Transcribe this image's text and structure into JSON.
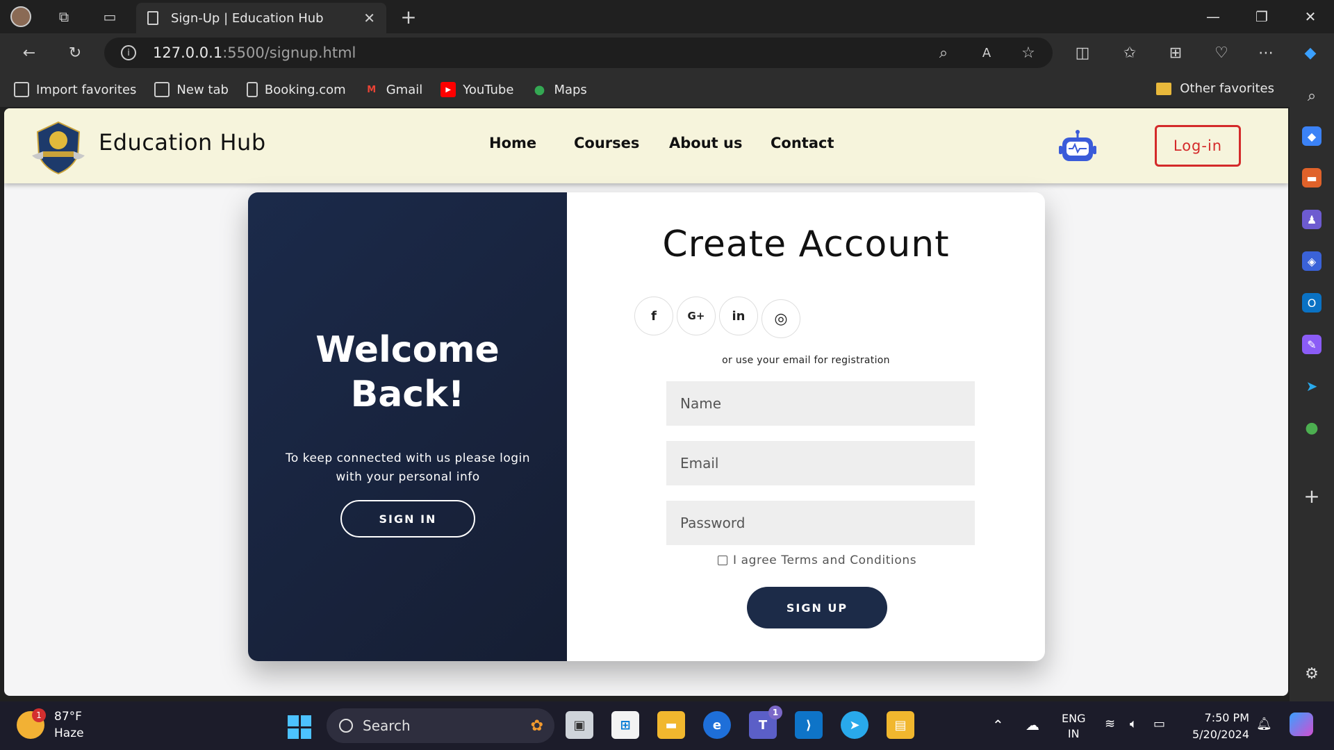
{
  "browser": {
    "tab_title": "Sign-Up | Education Hub",
    "url_host": "127.0.0.1",
    "url_rest": ":5500/signup.html",
    "favorites": [
      {
        "label": "Import favorites",
        "icon": "import-icon"
      },
      {
        "label": "New tab",
        "icon": "new-tab-icon"
      },
      {
        "label": "Booking.com",
        "icon": "page-icon"
      },
      {
        "label": "Gmail",
        "icon": "gmail-icon"
      },
      {
        "label": "YouTube",
        "icon": "youtube-icon"
      },
      {
        "label": "Maps",
        "icon": "maps-icon"
      }
    ],
    "other_favorites": "Other favorites"
  },
  "site": {
    "brand": "Education Hub",
    "nav": [
      "Home",
      "Courses",
      "About us",
      "Contact"
    ],
    "login_label": "Log-in",
    "colors": {
      "header_bg": "#f6f4dc",
      "panel_bg": "#1b2a4a",
      "login": "#d42a2a"
    }
  },
  "left_panel": {
    "title_line1": "Welcome",
    "title_line2": "Back!",
    "text": "To keep connected with us please login with your personal info",
    "button": "SIGN IN"
  },
  "form": {
    "title": "Create Account",
    "social": [
      {
        "label": "f",
        "icon": "facebook-icon"
      },
      {
        "label": "G+",
        "icon": "google-plus-icon"
      },
      {
        "label": "in",
        "icon": "linkedin-icon"
      },
      {
        "label": "◎",
        "icon": "instagram-icon"
      }
    ],
    "or_text": "or use your email for registration",
    "name_placeholder": "Name",
    "email_placeholder": "Email",
    "password_placeholder": "Password",
    "agree_text": "I agree Terms and Conditions",
    "submit": "SIGN UP"
  },
  "taskbar": {
    "weather_temp": "87°F",
    "weather_desc": "Haze",
    "weather_badge": "1",
    "search_label": "Search",
    "teams_badge": "1",
    "lang1": "ENG",
    "lang2": "IN",
    "time": "7:50 PM",
    "date": "5/20/2024"
  }
}
